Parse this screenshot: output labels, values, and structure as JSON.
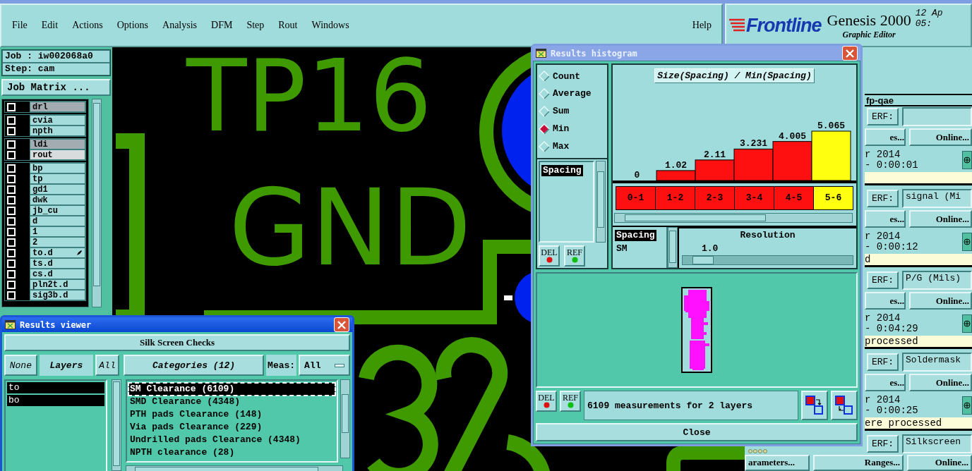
{
  "menu_bar": {
    "items": [
      "File",
      "Edit",
      "Actions",
      "Options",
      "Analysis",
      "DFM",
      "Step",
      "Rout",
      "Windows"
    ],
    "help": "Help"
  },
  "brand": {
    "logo": "Frontline",
    "product": "Genesis 2000",
    "subtitle": "Graphic Editor",
    "date": "12 Ap",
    "time": "05:"
  },
  "job_panel": {
    "job": "Job : iw002068a0",
    "step": "Step: cam",
    "matrix_button": "Job Matrix ...",
    "layer_groups": [
      [
        {
          "name": "drl",
          "checked": false,
          "color": "#a3acb0",
          "work_layer": false
        }
      ],
      [
        {
          "name": "cvia",
          "checked": false,
          "color": "#a4dcdc",
          "work_layer": false
        },
        {
          "name": "npth",
          "checked": false,
          "color": "#a4dcdc",
          "work_layer": false
        }
      ],
      [
        {
          "name": "ldi",
          "checked": false,
          "color": "#a3acb0",
          "work_layer": false
        },
        {
          "name": "rout",
          "checked": false,
          "color": "#d9dcdc",
          "work_layer": false
        }
      ],
      [
        {
          "name": "bp",
          "checked": false,
          "color": "#a4dcdc",
          "work_layer": false
        },
        {
          "name": "tp",
          "checked": false,
          "color": "#a4dcdc",
          "work_layer": false
        },
        {
          "name": "gd1",
          "checked": false,
          "color": "#a4dcdc",
          "work_layer": false
        },
        {
          "name": "dwk",
          "checked": false,
          "color": "#a4dcdc",
          "work_layer": false
        },
        {
          "name": "jb_cu",
          "checked": false,
          "color": "#a4dcdc",
          "work_layer": false
        },
        {
          "name": "d",
          "checked": false,
          "color": "#a4dcdc",
          "work_layer": false
        },
        {
          "name": "1",
          "checked": false,
          "color": "#a4dcdc",
          "work_layer": false
        },
        {
          "name": "2",
          "checked": false,
          "color": "#a4dcdc",
          "work_layer": false
        },
        {
          "name": "to.d",
          "checked": false,
          "color": "#a4dcdc",
          "work_layer": true
        },
        {
          "name": "ts.d",
          "checked": false,
          "color": "#a4dcdc",
          "work_layer": false
        },
        {
          "name": "cs.d",
          "checked": false,
          "color": "#a4dcdc",
          "work_layer": false
        },
        {
          "name": "pln2t.d",
          "checked": false,
          "color": "#a4dcdc",
          "work_layer": false
        },
        {
          "name": "sig3b.d",
          "checked": false,
          "color": "#a4dcdc",
          "work_layer": false
        }
      ]
    ]
  },
  "canvas": {
    "labels": [
      "TP16",
      "GND"
    ]
  },
  "right_panel": {
    "header": "fp-qae",
    "blocks": [
      {
        "erf_label": "ERF:",
        "buttons": [
          "es...",
          "Online..."
        ],
        "date": "r 2014",
        "elapsed": "- 0:00:01"
      },
      {
        "erf_label": "ERF:",
        "erf_value": "signal (Mi",
        "buttons": [
          "es...",
          "Online..."
        ],
        "date": "r 2014",
        "elapsed": "- 0:00:12",
        "status": "d"
      },
      {
        "erf_label": "ERF:",
        "erf_value": "P/G (Mils)",
        "buttons": [
          "es...",
          "Online..."
        ],
        "date": "r 2014",
        "elapsed": "- 0:04:29",
        "status": "processed"
      },
      {
        "erf_label": "ERF:",
        "erf_value": "Soldermask",
        "buttons": [
          "es...",
          "Online..."
        ],
        "date": "r 2014",
        "elapsed": "- 0:00:25",
        "status": "ere processed"
      },
      {
        "erf_label": "ERF:",
        "erf_value": "Silkscreen"
      }
    ],
    "bottom_buttons": [
      "arameters...",
      "Ranges...",
      "Online..."
    ]
  },
  "results_viewer": {
    "title": "Results viewer",
    "check_set": "Silk Screen Checks",
    "none_button": "None",
    "layers_label": "Layers",
    "all_button": "All",
    "categories_button": "Categories (12)",
    "meas_label": "Meas:",
    "meas_value": "All",
    "layers": [
      {
        "text": "to",
        "selected": true
      },
      {
        "text": "bo",
        "selected": true
      }
    ],
    "categories": [
      {
        "text": "SM Clearance (6109)",
        "selected": true
      },
      {
        "text": "SMD Clearance (4348)",
        "selected": false
      },
      {
        "text": "PTH pads Clearance (148)",
        "selected": false
      },
      {
        "text": "Via pads Clearance (229)",
        "selected": false
      },
      {
        "text": "Undrilled pads Clearance (4348)",
        "selected": false
      },
      {
        "text": "NPTH clearance (28)",
        "selected": false
      }
    ]
  },
  "results_histogram": {
    "title": "Results histogram",
    "modes": [
      {
        "label": "Count",
        "selected": false
      },
      {
        "label": "Average",
        "selected": false
      },
      {
        "label": "Sum",
        "selected": false
      },
      {
        "label": "Min",
        "selected": true
      },
      {
        "label": "Max",
        "selected": false
      }
    ],
    "measures": [
      {
        "text": "Spacing",
        "selected": true
      }
    ],
    "list_buttons": [
      "DEL",
      "REF"
    ],
    "chart_data": {
      "type": "bar",
      "title": "Size(Spacing) / Min(Spacing)",
      "categories": [
        "0-1",
        "1-2",
        "2-3",
        "3-4",
        "4-5",
        "5-6"
      ],
      "values": [
        0,
        1.02,
        2.11,
        3.231,
        4.005,
        5.065
      ],
      "data_labels": true
    },
    "bins": [
      {
        "selected": false
      },
      {
        "selected": false
      },
      {
        "selected": false
      },
      {
        "selected": false
      },
      {
        "selected": false
      },
      {
        "selected": true
      }
    ],
    "attributes": [
      {
        "text": "Spacing",
        "selected": true
      },
      {
        "text": "SM",
        "selected": false
      }
    ],
    "resolution": {
      "label": "Resolution",
      "value": "1.0",
      "level": 0.06
    },
    "status_buttons": [
      "DEL",
      "REF"
    ],
    "summary": "6109 measurements for 2 layers",
    "close_button": "Close"
  }
}
